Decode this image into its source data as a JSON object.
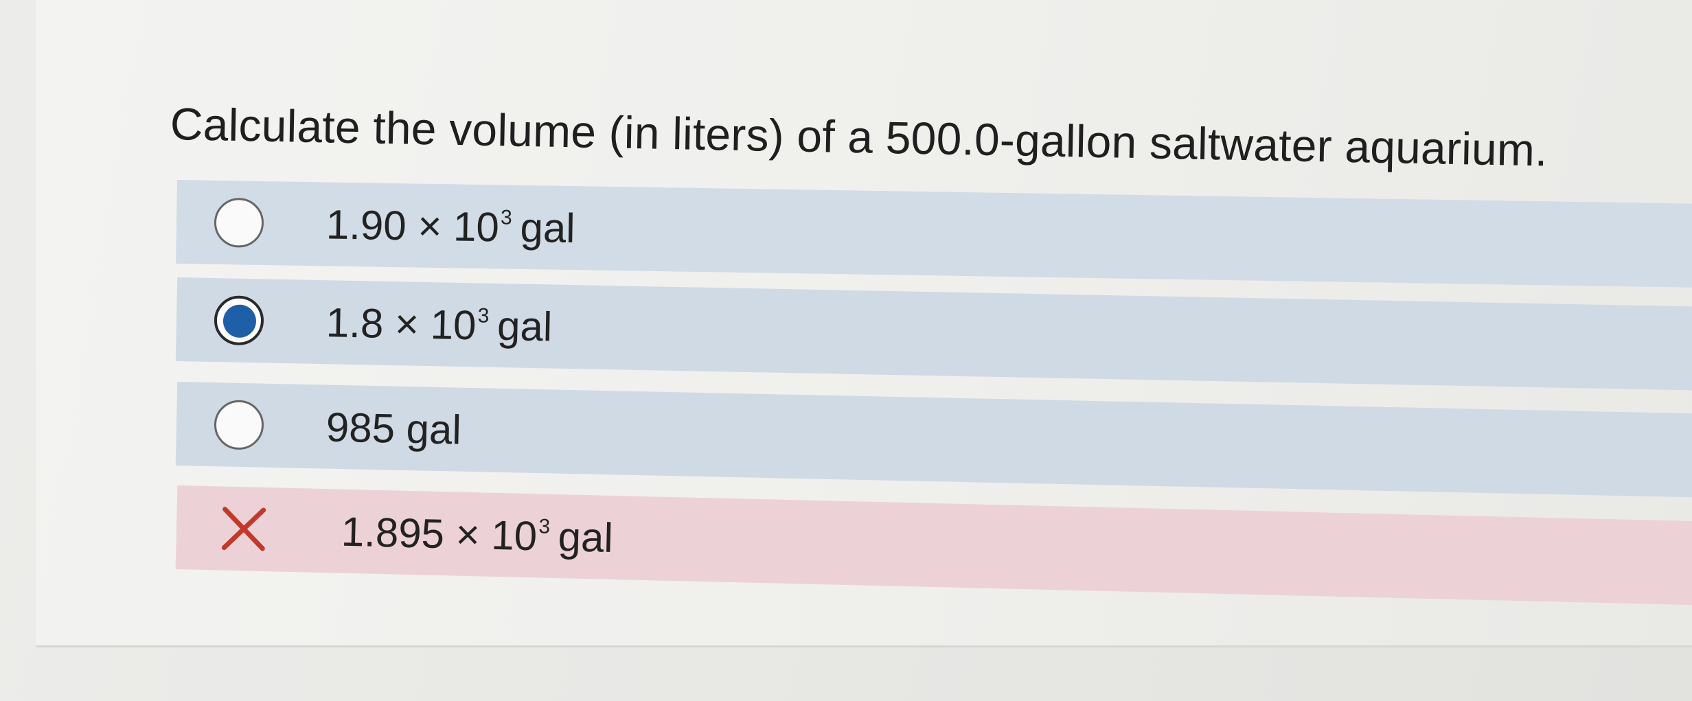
{
  "question": {
    "text": "Calculate the volume (in liters) of a 500.0-gallon saltwater aquarium."
  },
  "options": [
    {
      "base": "1.90 × 10",
      "exponent": "3",
      "unit": "gal",
      "state": "unselected"
    },
    {
      "base": "1.8 × 10",
      "exponent": "3",
      "unit": "gal",
      "state": "selected"
    },
    {
      "base": "985",
      "exponent": "",
      "unit": "gal",
      "state": "unselected"
    },
    {
      "base": "1.895 × 10",
      "exponent": "3",
      "unit": "gal",
      "state": "incorrect"
    }
  ],
  "colors": {
    "option_bg": "#d0dae5",
    "incorrect_bg": "#ecd2d6",
    "selected_fill": "#1f5fa8",
    "incorrect_mark": "#c0392b"
  },
  "icons": {
    "radio": "radio-button-icon",
    "selected_radio": "radio-button-selected-icon",
    "incorrect": "x-mark-icon"
  }
}
